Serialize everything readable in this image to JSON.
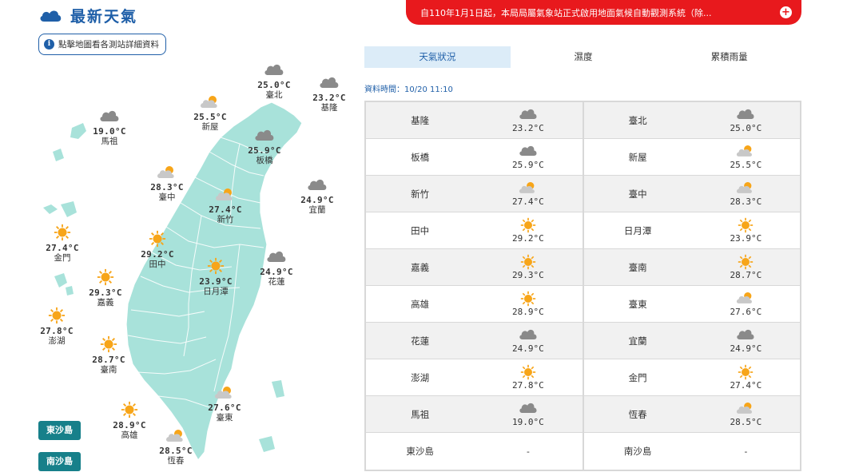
{
  "header": {
    "title": "最新天氣"
  },
  "notice": {
    "text": "自110年1月1日起，本局局屬氣象站正式啟用地面氣候自動觀測系統（除...",
    "plus": "+"
  },
  "map_hint": {
    "icon": "i",
    "text": "點擊地圖看各測站詳細資料"
  },
  "tabs": [
    {
      "label": "天氣狀況",
      "active": true
    },
    {
      "label": "濕度",
      "active": false
    },
    {
      "label": "累積雨量",
      "active": false
    }
  ],
  "data_time": "資料時間：10/20 11:10",
  "map_stations": [
    {
      "id": "taipei",
      "name": "臺北",
      "temp": "25.0°C",
      "icon": "cloudy-icon"
    },
    {
      "id": "keelung",
      "name": "基隆",
      "temp": "23.2°C",
      "icon": "cloudy-icon"
    },
    {
      "id": "hsinwu",
      "name": "新屋",
      "temp": "25.5°C",
      "icon": "partly-cloudy-icon"
    },
    {
      "id": "banqiao",
      "name": "板橋",
      "temp": "25.9°C",
      "icon": "cloudy-icon"
    },
    {
      "id": "matsu",
      "name": "馬祖",
      "temp": "19.0°C",
      "icon": "cloudy-icon"
    },
    {
      "id": "taichung",
      "name": "臺中",
      "temp": "28.3°C",
      "icon": "partly-cloudy-icon"
    },
    {
      "id": "hsinchu",
      "name": "新竹",
      "temp": "27.4°C",
      "icon": "partly-cloudy-icon"
    },
    {
      "id": "yilan",
      "name": "宜蘭",
      "temp": "24.9°C",
      "icon": "cloudy-icon"
    },
    {
      "id": "kinmen",
      "name": "金門",
      "temp": "27.4°C",
      "icon": "sunny-icon"
    },
    {
      "id": "tianzhong",
      "name": "田中",
      "temp": "29.2°C",
      "icon": "sunny-icon"
    },
    {
      "id": "sunmoonlake",
      "name": "日月潭",
      "temp": "23.9°C",
      "icon": "sunny-icon"
    },
    {
      "id": "hualien",
      "name": "花蓮",
      "temp": "24.9°C",
      "icon": "cloudy-icon"
    },
    {
      "id": "chiayi",
      "name": "嘉義",
      "temp": "29.3°C",
      "icon": "sunny-icon"
    },
    {
      "id": "penghu",
      "name": "澎湖",
      "temp": "27.8°C",
      "icon": "sunny-icon"
    },
    {
      "id": "tainan",
      "name": "臺南",
      "temp": "28.7°C",
      "icon": "sunny-icon"
    },
    {
      "id": "taitung",
      "name": "臺東",
      "temp": "27.6°C",
      "icon": "partly-cloudy-icon"
    },
    {
      "id": "kaohsiung",
      "name": "高雄",
      "temp": "28.9°C",
      "icon": "sunny-icon"
    },
    {
      "id": "hengchun",
      "name": "恆春",
      "temp": "28.5°C",
      "icon": "partly-cloudy-icon"
    }
  ],
  "island_buttons": [
    {
      "label": "東沙島"
    },
    {
      "label": "南沙島"
    }
  ],
  "table_rows": [
    [
      {
        "name": "基隆",
        "temp": "23.2°C",
        "icon": "cloudy-icon"
      },
      {
        "name": "臺北",
        "temp": "25.0°C",
        "icon": "cloudy-icon"
      }
    ],
    [
      {
        "name": "板橋",
        "temp": "25.9°C",
        "icon": "cloudy-icon"
      },
      {
        "name": "新屋",
        "temp": "25.5°C",
        "icon": "partly-cloudy-icon"
      }
    ],
    [
      {
        "name": "新竹",
        "temp": "27.4°C",
        "icon": "partly-cloudy-icon"
      },
      {
        "name": "臺中",
        "temp": "28.3°C",
        "icon": "partly-cloudy-icon"
      }
    ],
    [
      {
        "name": "田中",
        "temp": "29.2°C",
        "icon": "sunny-icon"
      },
      {
        "name": "日月潭",
        "temp": "23.9°C",
        "icon": "sunny-icon"
      }
    ],
    [
      {
        "name": "嘉義",
        "temp": "29.3°C",
        "icon": "sunny-icon"
      },
      {
        "name": "臺南",
        "temp": "28.7°C",
        "icon": "sunny-icon"
      }
    ],
    [
      {
        "name": "高雄",
        "temp": "28.9°C",
        "icon": "sunny-icon"
      },
      {
        "name": "臺東",
        "temp": "27.6°C",
        "icon": "partly-cloudy-icon"
      }
    ],
    [
      {
        "name": "花蓮",
        "temp": "24.9°C",
        "icon": "cloudy-icon"
      },
      {
        "name": "宜蘭",
        "temp": "24.9°C",
        "icon": "cloudy-icon"
      }
    ],
    [
      {
        "name": "澎湖",
        "temp": "27.8°C",
        "icon": "sunny-icon"
      },
      {
        "name": "金門",
        "temp": "27.4°C",
        "icon": "sunny-icon"
      }
    ],
    [
      {
        "name": "馬祖",
        "temp": "19.0°C",
        "icon": "cloudy-icon"
      },
      {
        "name": "恆春",
        "temp": "28.5°C",
        "icon": "partly-cloudy-icon"
      }
    ],
    [
      {
        "name": "東沙島",
        "temp": "-",
        "icon": ""
      },
      {
        "name": "南沙島",
        "temp": "-",
        "icon": ""
      }
    ]
  ],
  "colors": {
    "brand_blue": "#1f5fa8",
    "notice_red": "#e8191d",
    "land": "#a8e2da",
    "island_button": "#17808a",
    "sun": "#f7a519",
    "cloud": "#8a8a8a"
  }
}
